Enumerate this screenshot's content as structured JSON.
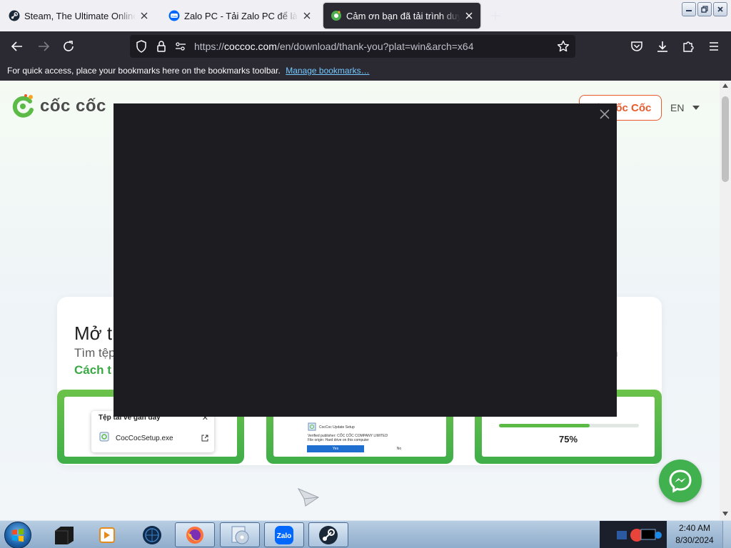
{
  "browser": {
    "tabs": [
      {
        "title": "Steam, The Ultimate Online Game Platform",
        "icon": "steam-icon",
        "active": false
      },
      {
        "title": "Zalo PC - Tải Zalo PC để làm việc",
        "icon": "zalo-icon",
        "active": false
      },
      {
        "title": "Cảm ơn bạn đã tải trình duyệt Cốc Cốc",
        "icon": "coccoc-icon",
        "active": true
      }
    ],
    "url": {
      "prefix": "https://",
      "host": "coccoc.com",
      "path": "/en/download/thank-you?plat=win&arch=x64"
    },
    "bookmarks_bar": {
      "message": "For quick access, place your bookmarks here on the bookmarks toolbar.",
      "manage_link": "Manage bookmarks…"
    }
  },
  "page": {
    "logo_text": "cốc cốc",
    "header_button": "Tải Cốc Cốc",
    "lang": "EN",
    "card": {
      "title": "Mở trình",
      "subtitle": "Tìm tệp",
      "link": "Cách t",
      "right_fragment": "n"
    },
    "step1": {
      "panel_title": "Tệp tải về gần đây",
      "file_name": "CocCocSetup.exe"
    },
    "step2": {
      "dialog_title": "CocCoc Update Setup",
      "publisher": "Verified publisher: CỐC CỐC COMPANY LIMITED",
      "origin": "File origin: Hard drive on this computer",
      "yes": "Yes",
      "no": "No"
    },
    "step3": {
      "progress_value": 0.65,
      "progress_label": "75%"
    }
  },
  "taskbar": {
    "time": "2:40 AM",
    "date": "8/30/2024",
    "items": [
      "app-icon",
      "media-player-icon",
      "globe-icon",
      "firefox-icon",
      "dvd-maker-icon",
      "zalo-icon",
      "steam-icon"
    ]
  },
  "colors": {
    "brand_green": "#3fae49",
    "brand_orange": "#e85a2c",
    "modal_bg": "#1d1c21",
    "browser_chrome": "#2b2a33"
  }
}
